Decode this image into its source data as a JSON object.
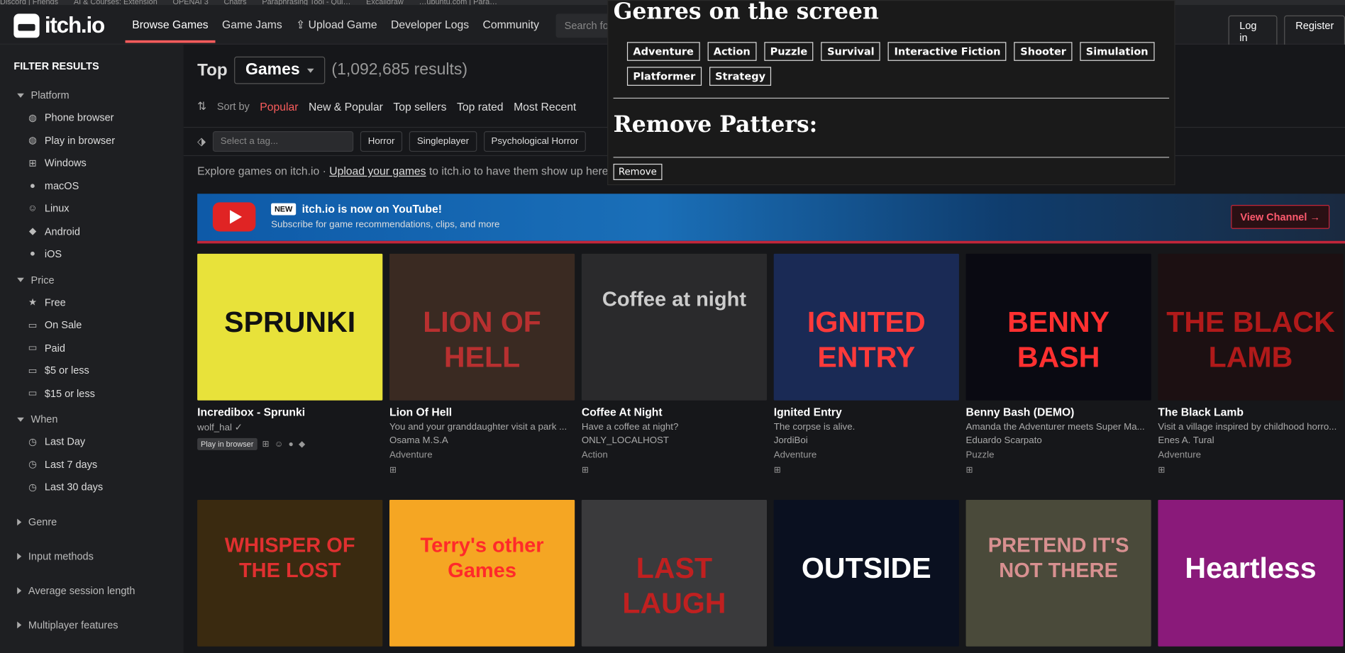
{
  "bookmarks": [
    "Discord | Friends",
    "AI & Courses: Extension",
    "OPENAI 3",
    "Chatrs",
    "Paraphrasing Tool - Qui…",
    "Excalidraw",
    "…ubuntu.com | Para…"
  ],
  "header": {
    "logo": "itch.io",
    "nav": [
      "Browse Games",
      "Game Jams",
      "Upload Game",
      "Developer Logs",
      "Community"
    ],
    "search_placeholder": "Search fo",
    "login": "Log in",
    "register": "Register"
  },
  "sidebar": {
    "title": "FILTER RESULTS",
    "platform": {
      "label": "Platform",
      "items": [
        {
          "icon": "◍",
          "label": "Phone browser"
        },
        {
          "icon": "◍",
          "label": "Play in browser"
        },
        {
          "icon": "⊞",
          "label": "Windows"
        },
        {
          "icon": "●",
          "label": "macOS"
        },
        {
          "icon": "☺",
          "label": "Linux"
        },
        {
          "icon": "◆",
          "label": "Android"
        },
        {
          "icon": "●",
          "label": "iOS"
        }
      ]
    },
    "price": {
      "label": "Price",
      "items": [
        {
          "icon": "★",
          "label": "Free"
        },
        {
          "icon": "▭",
          "label": "On Sale"
        },
        {
          "icon": "▭",
          "label": "Paid"
        },
        {
          "icon": "▭",
          "label": "$5 or less"
        },
        {
          "icon": "▭",
          "label": "$15 or less"
        }
      ]
    },
    "when": {
      "label": "When",
      "items": [
        {
          "icon": "◷",
          "label": "Last Day"
        },
        {
          "icon": "◷",
          "label": "Last 7 days"
        },
        {
          "icon": "◷",
          "label": "Last 30 days"
        }
      ]
    },
    "collapsed": [
      "Genre",
      "Input methods",
      "Average session length",
      "Multiplayer features"
    ]
  },
  "main": {
    "top": "Top",
    "games_select": "Games",
    "count": "(1,092,685 results)",
    "sort_label": "Sort by",
    "sort": [
      "Popular",
      "New & Popular",
      "Top sellers",
      "Top rated",
      "Most Recent"
    ],
    "tag_placeholder": "Select a tag...",
    "tags": [
      "Horror",
      "Singleplayer",
      "Psychological Horror"
    ],
    "explore_pre": "Explore games on itch.io · ",
    "explore_link": "Upload your games",
    "explore_post": " to itch.io to have them show up here.",
    "banner": {
      "badge": "NEW",
      "headline": "itch.io is now on YouTube!",
      "sub": "Subscribe for game recommendations, clips, and more",
      "cta": "View Channel →"
    }
  },
  "games": [
    {
      "title": "Incredibox - Sprunki",
      "desc": "",
      "author": "wolf_hal ✓",
      "genre": "",
      "pib": "Play in browser",
      "thumb_text": "SPRUNKI",
      "bg": "#e8e23a",
      "fg": "#111"
    },
    {
      "title": "Lion Of Hell",
      "desc": "You and your granddaughter visit a park ...",
      "author": "Osama M.S.A",
      "genre": "Adventure",
      "thumb_text": "LION OF HELL",
      "bg": "#3a2a22",
      "fg": "#b83030"
    },
    {
      "title": "Coffee At Night",
      "desc": "Have a coffee at night?",
      "author": "ONLY_LOCALHOST",
      "genre": "Action",
      "thumb_text": "Coffee at night",
      "bg": "#2a2a2c",
      "fg": "#cccccc"
    },
    {
      "title": "Ignited Entry",
      "desc": "The corpse is alive.",
      "author": "JordiBoi",
      "genre": "Adventure",
      "thumb_text": "IGNITED ENTRY",
      "bg": "#1a2a55",
      "fg": "#ff3a3a"
    },
    {
      "title": "Benny Bash (DEMO)",
      "desc": "Amanda the Adventurer meets Super Ma...",
      "author": "Eduardo Scarpato",
      "genre": "Puzzle",
      "thumb_text": "BENNY BASH",
      "bg": "#0a0a12",
      "fg": "#ff3030"
    },
    {
      "title": "The Black Lamb",
      "desc": "Visit a village inspired by childhood horro...",
      "author": "Enes A. Tural",
      "genre": "Adventure",
      "thumb_text": "THE BLACK LAMB",
      "bg": "#1c1012",
      "fg": "#b01a1a"
    },
    {
      "thumb_text": "WHISPER OF THE LOST",
      "bg": "#3a2a10",
      "fg": "#e03030"
    },
    {
      "thumb_text": "Terry's other Games",
      "bg": "#f5a623",
      "fg": "#ff2a2a"
    },
    {
      "thumb_text": "LAST LAUGH",
      "bg": "#3a3a3c",
      "fg": "#c02020"
    },
    {
      "thumb_text": "OUTSIDE",
      "bg": "#0a1020",
      "fg": "#ffffff"
    },
    {
      "thumb_text": "PRETEND IT'S NOT THERE",
      "bg": "#4a4a3a",
      "fg": "#d89090"
    },
    {
      "thumb_text": "Heartless",
      "bg": "#8a1a7a",
      "fg": "#ffffff"
    }
  ],
  "overlay": {
    "heading": "Genres on the screen",
    "genres": [
      "Adventure",
      "Action",
      "Puzzle",
      "Survival",
      "Interactive Fiction",
      "Shooter",
      "Simulation",
      "Platformer",
      "Strategy"
    ],
    "heading2": "Remove Patters:",
    "button": "Remove"
  }
}
